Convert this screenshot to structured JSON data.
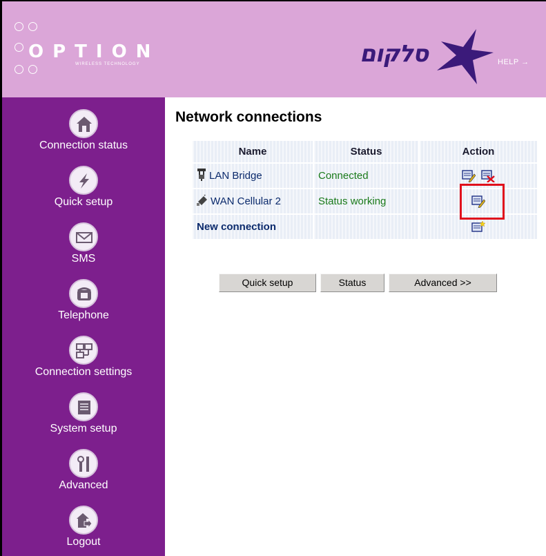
{
  "header": {
    "logo_word": "OPTION",
    "logo_tagline": "WIRELESS TECHNOLOGY",
    "brand_name": "סלקום",
    "help_link": "HELP →"
  },
  "sidebar": {
    "items": [
      {
        "label": "Connection status",
        "icon": "home-icon"
      },
      {
        "label": "Quick setup",
        "icon": "lightning-icon"
      },
      {
        "label": "SMS",
        "icon": "envelope-icon"
      },
      {
        "label": "Telephone",
        "icon": "telephone-icon"
      },
      {
        "label": "Connection settings",
        "icon": "network-icon"
      },
      {
        "label": "System setup",
        "icon": "document-icon"
      },
      {
        "label": "Advanced",
        "icon": "tools-icon"
      },
      {
        "label": "Logout",
        "icon": "logout-icon"
      }
    ]
  },
  "main": {
    "title": "Network connections",
    "table": {
      "columns": [
        "Name",
        "Status",
        "Action"
      ],
      "rows": [
        {
          "name": "LAN Bridge",
          "status": "Connected",
          "icon": "lan-plug-icon",
          "actions": [
            "edit",
            "delete"
          ]
        },
        {
          "name": "WAN Cellular 2",
          "status": "Status working",
          "icon": "wan-plug-icon",
          "actions": [
            "edit"
          ]
        }
      ],
      "new_connection": "New connection"
    },
    "buttons": {
      "quick_setup": "Quick setup",
      "status": "Status",
      "advanced": "Advanced >>"
    }
  },
  "colors": {
    "header_bg": "#dba6d8",
    "sidebar_bg": "#7d1f8d",
    "highlight": "#e0101c",
    "status_green": "#1a7a1a",
    "link_blue": "#0b2a6c"
  }
}
